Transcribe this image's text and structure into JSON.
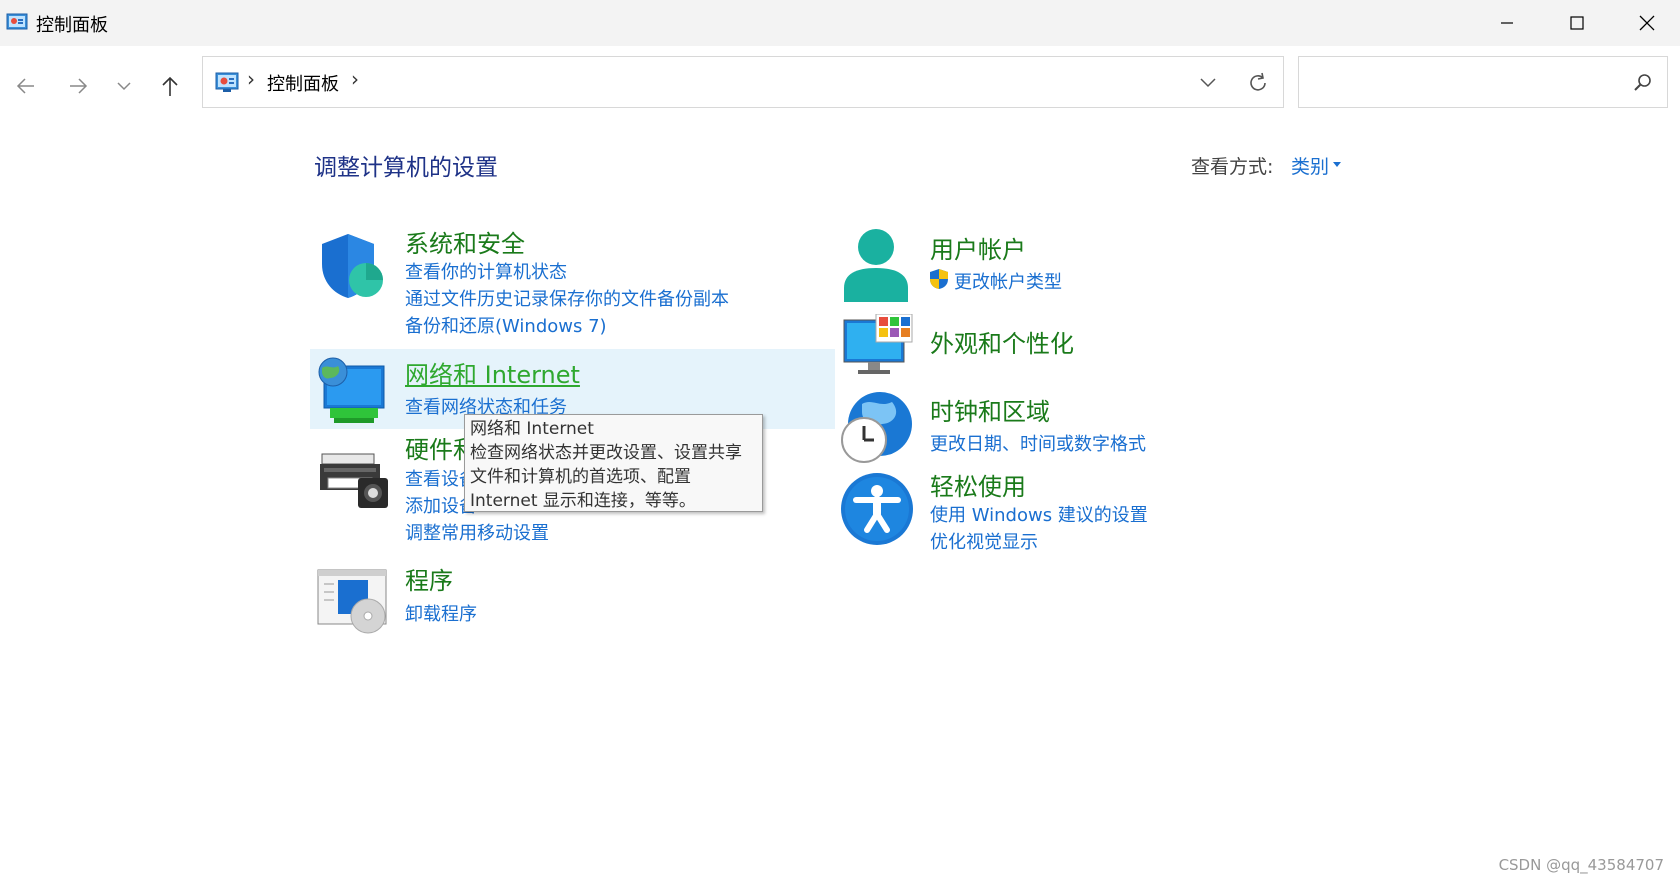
{
  "window": {
    "title": "控制面板"
  },
  "address": {
    "path_item": "控制面板",
    "separator": "›"
  },
  "search": {
    "placeholder": ""
  },
  "page": {
    "heading": "调整计算机的设置",
    "view_by_label": "查看方式:",
    "view_by_value": "类别"
  },
  "categories": {
    "system": {
      "title": "系统和安全",
      "links": [
        "查看你的计算机状态",
        "通过文件历史记录保存你的文件备份副本",
        "备份和还原(Windows 7)"
      ]
    },
    "network": {
      "title": "网络和 Internet",
      "links": [
        "查看网络状态和任务"
      ]
    },
    "hardware": {
      "title": "硬件和声音",
      "links": [
        "查看设备和打印机",
        "添加设备",
        "调整常用移动设置"
      ]
    },
    "programs": {
      "title": "程序",
      "links": [
        "卸载程序"
      ]
    },
    "users": {
      "title": "用户帐户",
      "links": [
        "更改帐户类型"
      ]
    },
    "appearance": {
      "title": "外观和个性化",
      "links": []
    },
    "clock": {
      "title": "时钟和区域",
      "links": [
        "更改日期、时间或数字格式"
      ]
    },
    "ease": {
      "title": "轻松使用",
      "links": [
        "使用 Windows 建议的设置",
        "优化视觉显示"
      ]
    }
  },
  "tooltip": {
    "lines": [
      "网络和 Internet",
      "检查网络状态并更改设置、设置共享",
      "文件和计算机的首选项、配置",
      "Internet 显示和连接，等等。"
    ]
  },
  "watermark": "CSDN @qq_43584707",
  "colors": {
    "category_title": "#1a7a1a",
    "link": "#1a6fd0",
    "heading": "#1e3287",
    "hover": "#e5f3fb"
  }
}
